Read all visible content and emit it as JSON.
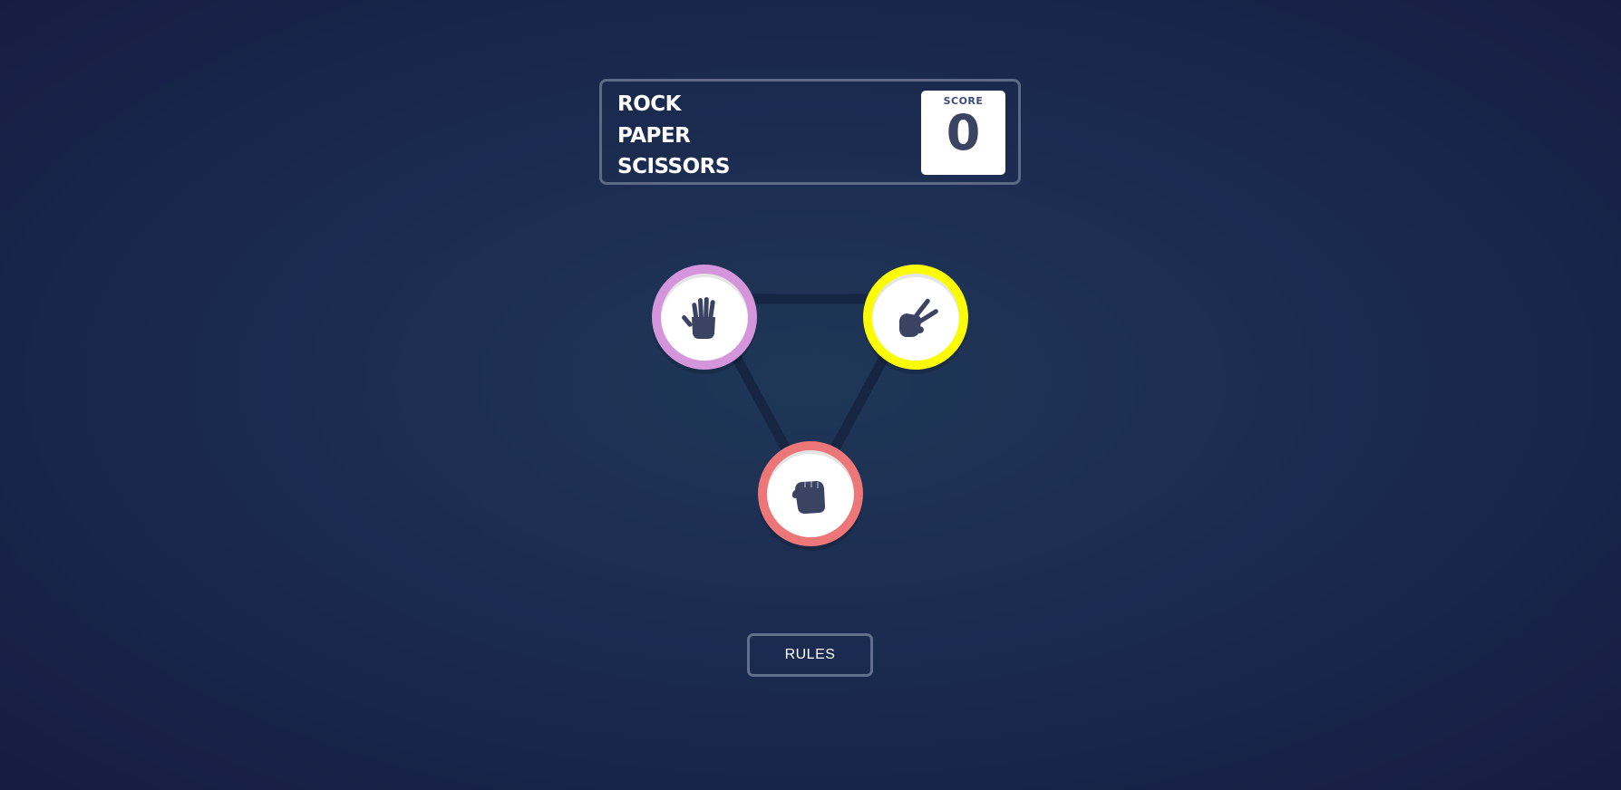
{
  "header": {
    "title_lines": [
      "ROCK",
      "PAPER",
      "SCISSORS"
    ],
    "score_label": "SCORE",
    "score_value": "0"
  },
  "tokens": [
    {
      "id": "paper",
      "icon": "paper-hand-icon",
      "ring_color": "#d595db"
    },
    {
      "id": "scissors",
      "icon": "scissors-hand-icon",
      "ring_color": "#fbfb08"
    },
    {
      "id": "rock",
      "icon": "rock-fist-icon",
      "ring_color": "#ec7678"
    }
  ],
  "colors": {
    "icon_fill": "#3b4363",
    "triangle_line": "#15233f"
  },
  "footer": {
    "rules_label": "RULES"
  }
}
